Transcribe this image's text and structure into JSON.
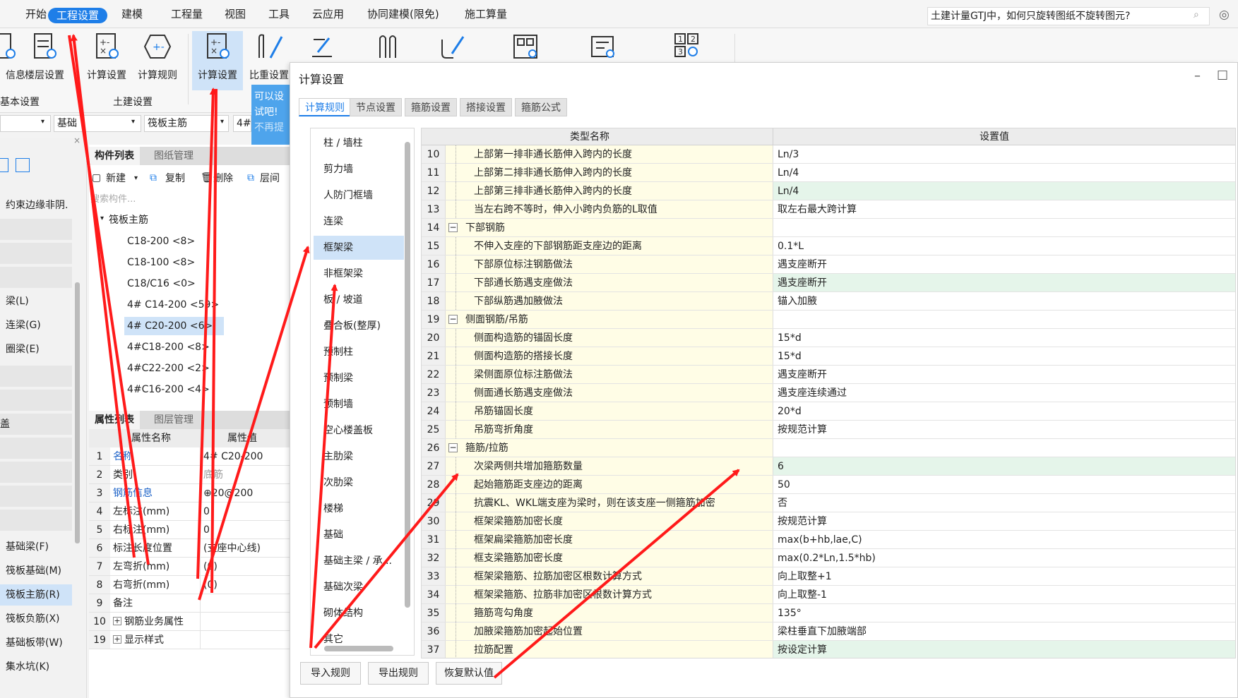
{
  "menu": {
    "items": [
      "开始",
      "工程设置",
      "建模",
      "工程量",
      "视图",
      "工具",
      "云应用",
      "协同建模(限免)",
      "施工算量"
    ],
    "active": "工程设置"
  },
  "search": {
    "value": "土建计量GTJ中，如何只旋转图纸不旋转图元?"
  },
  "ribbon": {
    "buttons": [
      "信息",
      "楼层设置",
      "计算设置",
      "计算规则",
      "计算设置",
      "比重设置"
    ],
    "groups": [
      "基本设置",
      "土建设置"
    ]
  },
  "tip": {
    "line1": "可以设",
    "line2": "试吧!",
    "line3": "不再提"
  },
  "left": {
    "combo1": "",
    "combo2": "基础",
    "combo3": "筏板主筋",
    "combo4": "4#",
    "items": [
      "约束边缘非阴.",
      "",
      "",
      "",
      "梁(L)",
      "连梁(G)",
      "圈梁(E)",
      "",
      "",
      "",
      "盖",
      "",
      "",
      "",
      "",
      "基础梁(F)",
      "筏板基础(M)",
      "筏板主筋(R)",
      "筏板负筋(X)",
      "基础板带(W)",
      "集水坑(K)"
    ]
  },
  "component": {
    "tabs": [
      "构件列表",
      "图纸管理"
    ],
    "toolbar": {
      "new": "新建",
      "copy": "复制",
      "delete": "删除",
      "floor": "层间"
    },
    "search_placeholder": "搜索构件...",
    "root": "筏板主筋",
    "nodes": [
      "C18-200 <8>",
      "C18-100 <8>",
      "C18/C16 <0>",
      "4# C14-200 <59>",
      "4# C20-200 <6>",
      "4#C18-200 <8>",
      "4#C22-200 <2>",
      "4#C16-200 <4>"
    ]
  },
  "props": {
    "tabs": [
      "属性列表",
      "图层管理"
    ],
    "headers": [
      "属性名称",
      "属性值"
    ],
    "rows": [
      {
        "no": "1",
        "name": "名称",
        "value": "4# C20-200"
      },
      {
        "no": "2",
        "name": "类别",
        "value": "底筋"
      },
      {
        "no": "3",
        "name": "钢筋信息",
        "value": "⊕20@200"
      },
      {
        "no": "4",
        "name": "左标注(mm)",
        "value": "0"
      },
      {
        "no": "5",
        "name": "右标注(mm)",
        "value": "0"
      },
      {
        "no": "6",
        "name": "标注长度位置",
        "value": "(支座中心线)"
      },
      {
        "no": "7",
        "name": "左弯折(mm)",
        "value": "(0)"
      },
      {
        "no": "8",
        "name": "右弯折(mm)",
        "value": "(0)"
      },
      {
        "no": "9",
        "name": "备注",
        "value": ""
      },
      {
        "no": "10",
        "name": "钢筋业务属性",
        "value": ""
      },
      {
        "no": "19",
        "name": "显示样式",
        "value": ""
      }
    ]
  },
  "dialog": {
    "title": "计算设置",
    "tabs": [
      "计算规则",
      "节点设置",
      "箍筋设置",
      "搭接设置",
      "箍筋公式"
    ],
    "categories": [
      "柱 / 墙柱",
      "剪力墙",
      "人防门框墙",
      "连梁",
      "框架梁",
      "非框架梁",
      "板 / 坡道",
      "叠合板(整厚)",
      "预制柱",
      "预制梁",
      "预制墙",
      "空心楼盖板",
      "主肋梁",
      "次肋梁",
      "楼梯",
      "基础",
      "基础主梁 / 承...",
      "基础次梁",
      "砌体结构",
      "其它"
    ],
    "selected_category": "框架梁",
    "grid_headers": [
      "类型名称",
      "设置值"
    ],
    "rows": [
      {
        "no": "10",
        "name": "上部第一排非通长筋伸入跨内的长度",
        "value": "Ln/3"
      },
      {
        "no": "11",
        "name": "上部第二排非通长筋伸入跨内的长度",
        "value": "Ln/4"
      },
      {
        "no": "12",
        "name": "上部第三排非通长筋伸入跨内的长度",
        "value": "Ln/4"
      },
      {
        "no": "13",
        "name": "当左右跨不等时，伸入小跨内负筋的L取值",
        "value": "取左右最大跨计算"
      },
      {
        "no": "14",
        "name": "下部钢筋",
        "value": ""
      },
      {
        "no": "15",
        "name": "不伸入支座的下部钢筋距支座边的距离",
        "value": "0.1*L"
      },
      {
        "no": "16",
        "name": "下部原位标注钢筋做法",
        "value": "遇支座断开"
      },
      {
        "no": "17",
        "name": "下部通长筋遇支座做法",
        "value": "遇支座断开"
      },
      {
        "no": "18",
        "name": "下部纵筋遇加腋做法",
        "value": "锚入加腋"
      },
      {
        "no": "19",
        "name": "侧面钢筋/吊筋",
        "value": ""
      },
      {
        "no": "20",
        "name": "侧面构造筋的锚固长度",
        "value": "15*d"
      },
      {
        "no": "21",
        "name": "侧面构造筋的搭接长度",
        "value": "15*d"
      },
      {
        "no": "22",
        "name": "梁侧面原位标注筋做法",
        "value": "遇支座断开"
      },
      {
        "no": "23",
        "name": "侧面通长筋遇支座做法",
        "value": "遇支座连续通过"
      },
      {
        "no": "24",
        "name": "吊筋锚固长度",
        "value": "20*d"
      },
      {
        "no": "25",
        "name": "吊筋弯折角度",
        "value": "按规范计算"
      },
      {
        "no": "26",
        "name": "箍筋/拉筋",
        "value": ""
      },
      {
        "no": "27",
        "name": "次梁两侧共增加箍筋数量",
        "value": "6"
      },
      {
        "no": "28",
        "name": "起始箍筋距支座边的距离",
        "value": "50"
      },
      {
        "no": "29",
        "name": "抗震KL、WKL端支座为梁时，则在该支座一侧箍筋加密",
        "value": "否"
      },
      {
        "no": "30",
        "name": "框架梁箍筋加密长度",
        "value": "按规范计算"
      },
      {
        "no": "31",
        "name": "框架扁梁箍筋加密长度",
        "value": "max(b+hb,lae,C)"
      },
      {
        "no": "32",
        "name": "框支梁箍筋加密长度",
        "value": "max(0.2*Ln,1.5*hb)"
      },
      {
        "no": "33",
        "name": "框架梁箍筋、拉筋加密区根数计算方式",
        "value": "向上取整+1"
      },
      {
        "no": "34",
        "name": "框架梁箍筋、拉筋非加密区根数计算方式",
        "value": "向上取整-1"
      },
      {
        "no": "35",
        "name": "箍筋弯勾角度",
        "value": "135°"
      },
      {
        "no": "36",
        "name": "加腋梁箍筋加密起始位置",
        "value": "梁柱垂直下加腋端部"
      },
      {
        "no": "37",
        "name": "拉筋配置",
        "value": "按设定计算"
      }
    ],
    "buttons": {
      "import": "导入规则",
      "export": "导出规则",
      "restore": "恢复默认值"
    }
  },
  "colors": {
    "accent": "#1e7ee8",
    "selection": "#cfe3f8",
    "highlight_row": "#e5f5ea",
    "arrow": "#ff1a1a"
  }
}
